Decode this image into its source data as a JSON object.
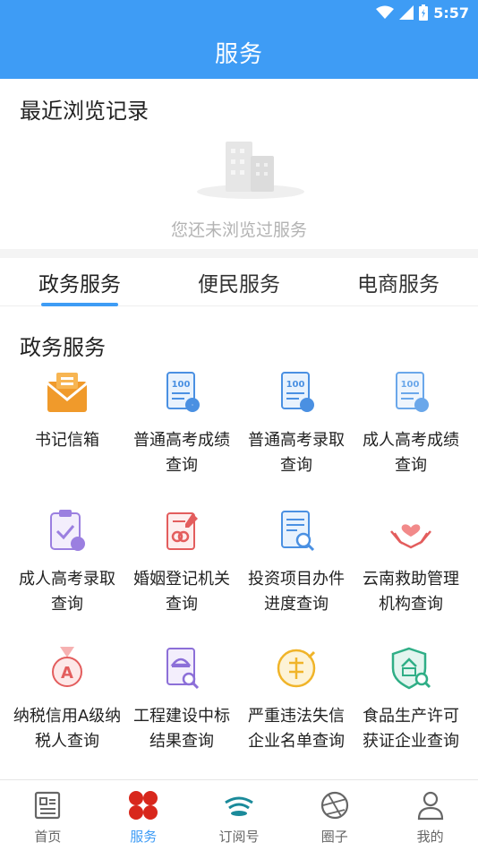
{
  "status": {
    "time": "5:57"
  },
  "appbar": {
    "title": "服务"
  },
  "recent": {
    "title": "最近浏览记录",
    "empty_text": "您还未浏览过服务"
  },
  "tabs": [
    {
      "label": "政务服务",
      "active": true
    },
    {
      "label": "便民服务",
      "active": false
    },
    {
      "label": "电商服务",
      "active": false
    }
  ],
  "section": {
    "title": "政务服务"
  },
  "services": [
    {
      "label": "书记信箱",
      "icon": "mailbox-icon"
    },
    {
      "label": "普通高考成绩查询",
      "icon": "score-report-icon"
    },
    {
      "label": "普通高考录取查询",
      "icon": "admission-report-icon"
    },
    {
      "label": "成人高考成绩查询",
      "icon": "adult-score-icon"
    },
    {
      "label": "成人高考录取查询",
      "icon": "clipboard-check-icon"
    },
    {
      "label": "婚姻登记机关查询",
      "icon": "marriage-register-icon"
    },
    {
      "label": "投资项目办件进度查询",
      "icon": "document-search-icon"
    },
    {
      "label": "云南救助管理机构查询",
      "icon": "heart-hands-icon"
    },
    {
      "label": "纳税信用A级纳税人查询",
      "icon": "medal-a-icon"
    },
    {
      "label": "工程建设中标结果查询",
      "icon": "construction-doc-icon"
    },
    {
      "label": "严重违法失信企业名单查询",
      "icon": "violation-icon"
    },
    {
      "label": "食品生产许可获证企业查询",
      "icon": "food-shield-icon"
    }
  ],
  "nav": [
    {
      "label": "首页",
      "icon": "news-icon",
      "active": false
    },
    {
      "label": "服务",
      "icon": "service-grid-icon",
      "active": true
    },
    {
      "label": "订阅号",
      "icon": "subscription-icon",
      "active": false
    },
    {
      "label": "圈子",
      "icon": "circle-icon",
      "active": false
    },
    {
      "label": "我的",
      "icon": "user-icon",
      "active": false
    }
  ],
  "colors": {
    "primary": "#3e9cf5",
    "accent_red": "#d8271c",
    "orange": "#f09a2b"
  }
}
